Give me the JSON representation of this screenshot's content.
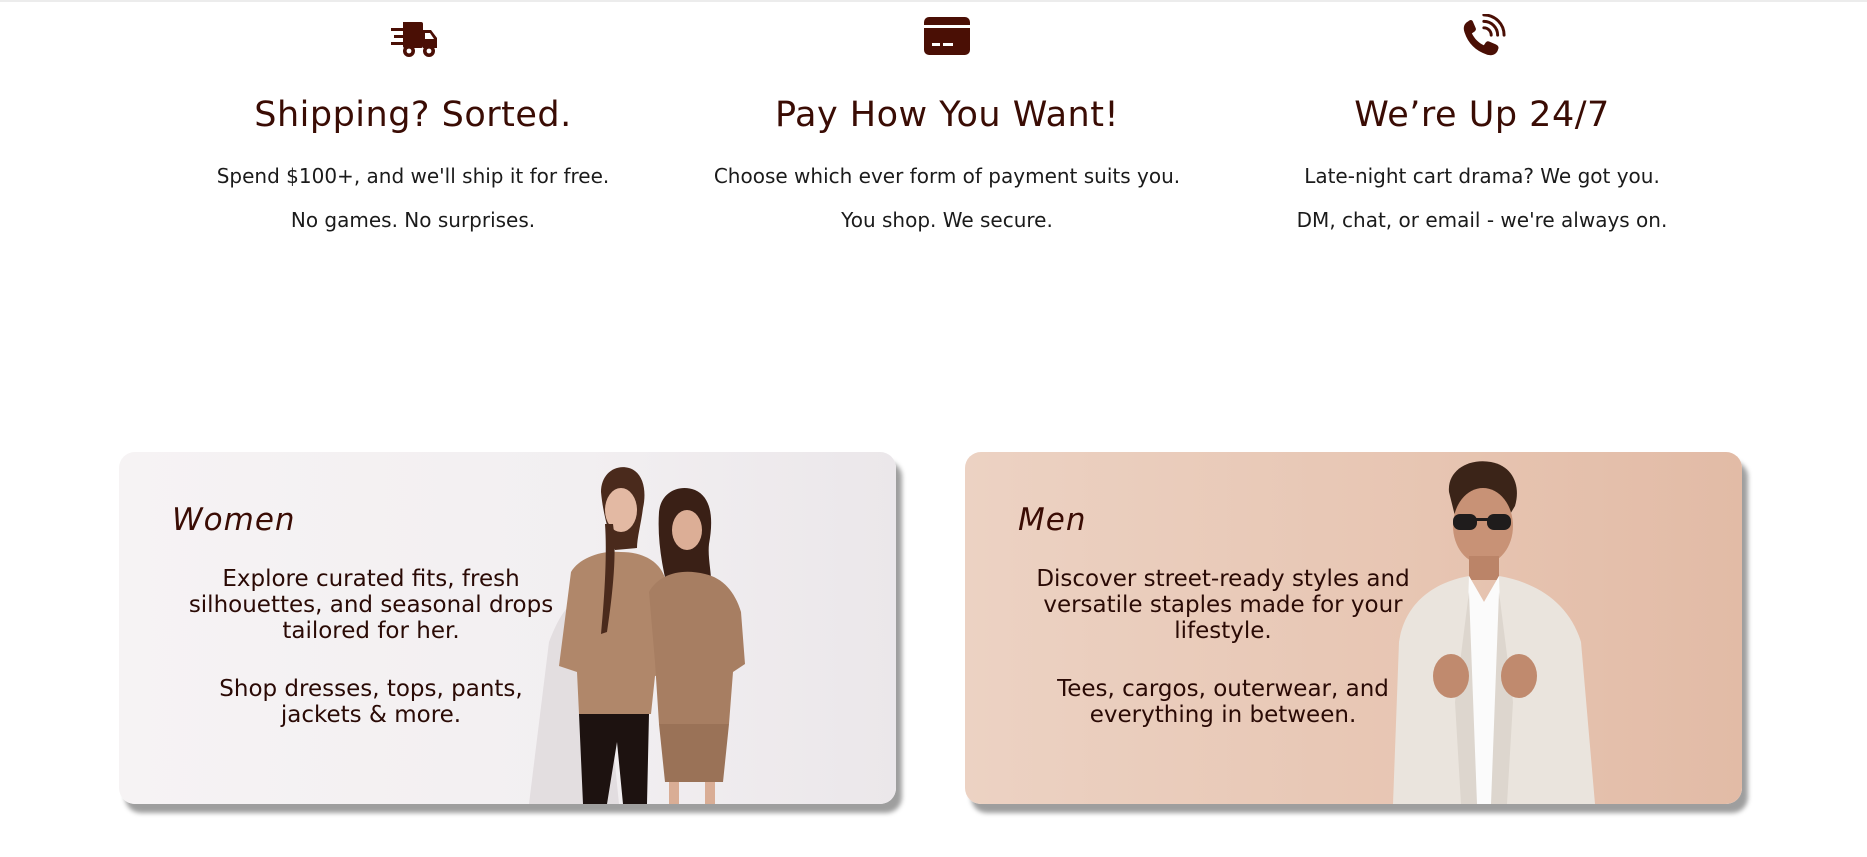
{
  "colors": {
    "brand": "#3a0c04",
    "women_card_bg": "#f3f0f2",
    "men_card_bg": "#e8c8b6"
  },
  "features": [
    {
      "icon": "truck-icon",
      "title": "Shipping? Sorted.",
      "line1": "Spend $100+, and we'll ship it for free.",
      "line2": "No games. No surprises."
    },
    {
      "icon": "credit-card-icon",
      "title": "Pay How You Want!",
      "line1": "Choose which ever form of payment suits you.",
      "line2": "You shop. We secure."
    },
    {
      "icon": "phone-ringing-icon",
      "title": "We’re Up 24/7",
      "line1": "Late-night cart drama? We got you.",
      "line2": "DM, chat, or email - we're always on."
    }
  ],
  "categories": {
    "women": {
      "title": "Women",
      "desc1": "Explore curated fits, fresh silhouettes, and seasonal drops tailored for her.",
      "desc2": "Shop dresses, tops, pants, jackets & more."
    },
    "men": {
      "title": "Men",
      "desc1": "Discover street-ready styles and versatile staples made for your lifestyle.",
      "desc2": "Tees, cargos, outerwear, and everything in between."
    }
  }
}
